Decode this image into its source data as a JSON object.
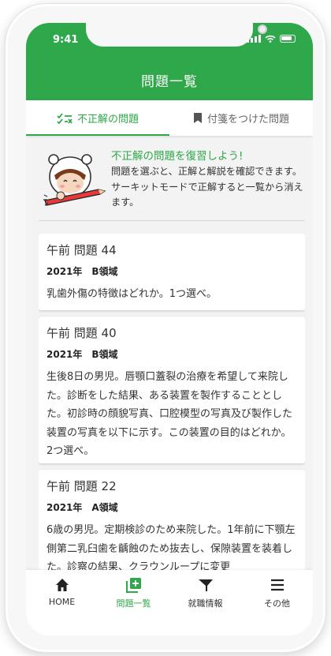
{
  "status_bar": {
    "time": "9:41"
  },
  "header": {
    "title": "問題一覧"
  },
  "tabs": [
    {
      "label": "不正解の問題",
      "icon": "checklist-icon",
      "active": true
    },
    {
      "label": "付箋をつけた問題",
      "icon": "bookmark-icon",
      "active": false
    }
  ],
  "intro": {
    "title": "不正解の問題を復習しよう!",
    "body": "問題を選ぶと、正解と解説を確認できます。サーキットモードで正解すると一覧から消えます。"
  },
  "questions": [
    {
      "title": "午前 問題 44",
      "meta": "2021年　B領域",
      "text": "乳歯外傷の特徴はどれか。1つ選べ。"
    },
    {
      "title": "午前 問題 40",
      "meta": "2021年　B領域",
      "text": "生後8日の男児。唇顎口蓋裂の治療を希望して来院した。診断をした結果、ある装置を製作することとした。初診時の顔貌写真、口腔模型の写真及び製作した装置の写真を以下に示す。この装置の目的はどれか。2つ選べ。"
    },
    {
      "title": "午前 問題 22",
      "meta": "2021年　A領域",
      "text": "6歳の男児。定期検診のため来院した。1年前に下顎左側第二乳臼歯を齲蝕のため抜去し、保隙装置を装着した。診察の結果、クラウンループに変更"
    }
  ],
  "bottom_nav": [
    {
      "label": "HOME",
      "icon": "home-icon",
      "active": false
    },
    {
      "label": "問題一覧",
      "icon": "add-list-icon",
      "active": true
    },
    {
      "label": "就職情報",
      "icon": "funnel-icon",
      "active": false
    },
    {
      "label": "その他",
      "icon": "menu-icon",
      "active": false
    }
  ],
  "colors": {
    "accent": "#2ea84a",
    "background": "#f3f3f3"
  }
}
